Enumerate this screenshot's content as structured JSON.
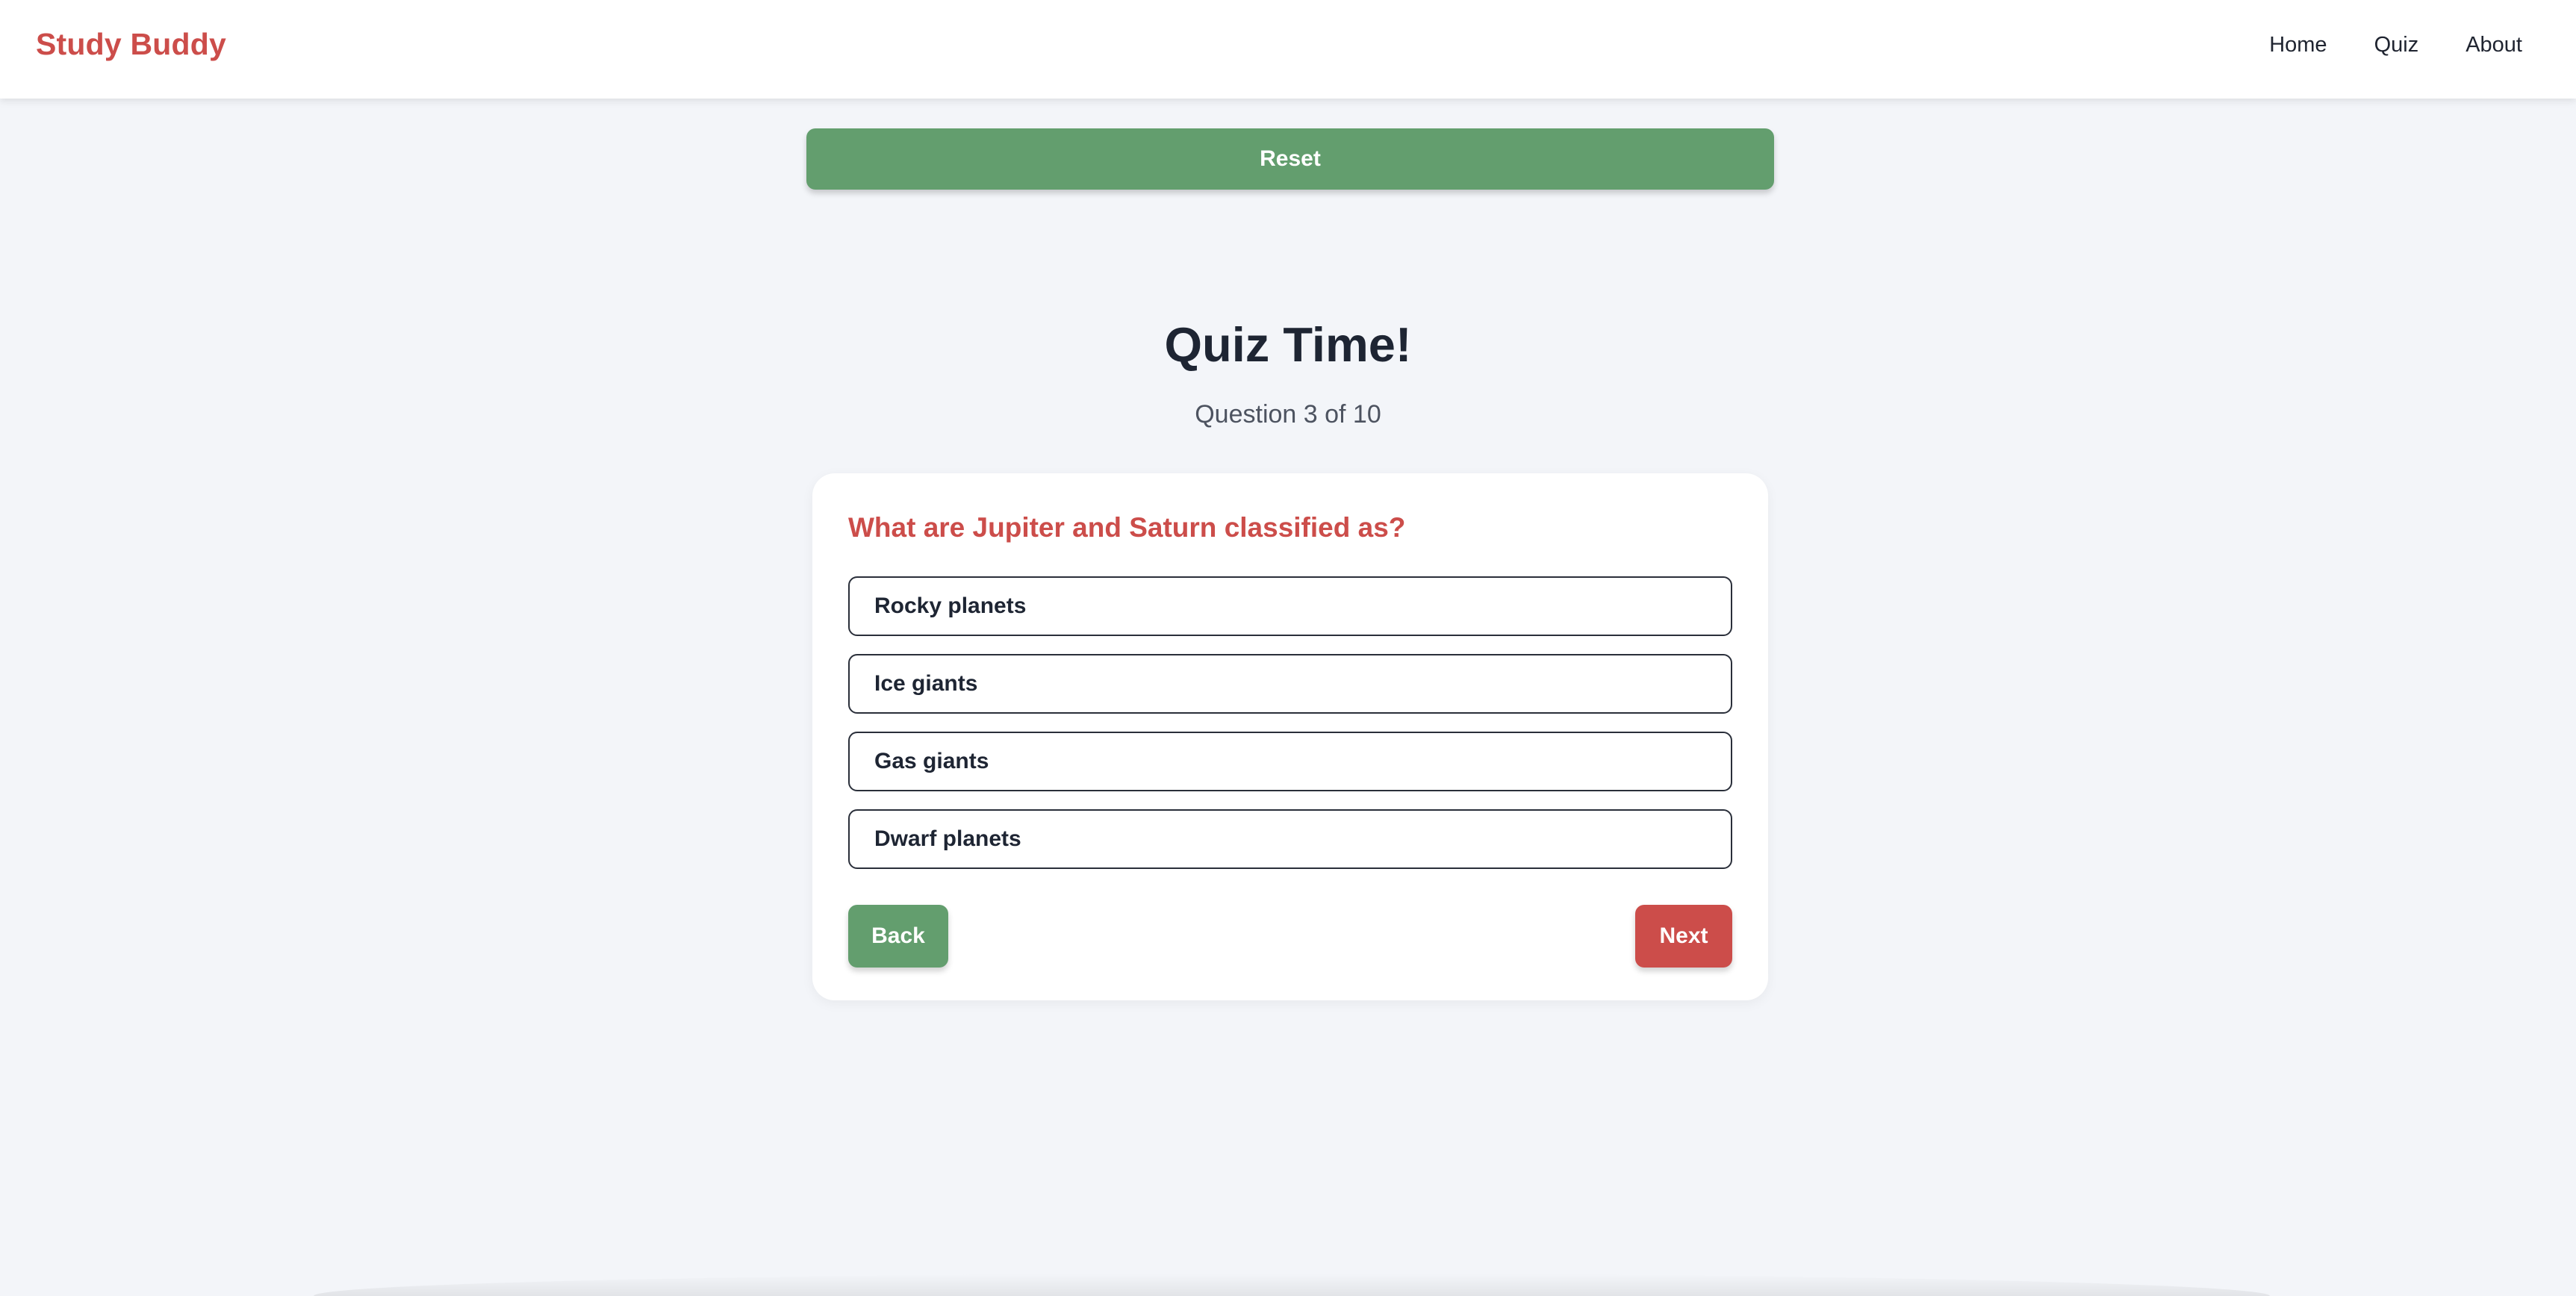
{
  "header": {
    "brand": "Study Buddy",
    "nav": [
      "Home",
      "Quiz",
      "About"
    ]
  },
  "toolbar": {
    "reset_label": "Reset"
  },
  "quiz": {
    "title": "Quiz Time!",
    "progress": "Question 3 of 10",
    "question": "What are Jupiter and Saturn classified as?",
    "options": [
      "Rocky planets",
      "Ice giants",
      "Gas giants",
      "Dwarf planets"
    ],
    "back_label": "Back",
    "next_label": "Next"
  },
  "colors": {
    "brand": "#cc4d4a",
    "green": "#639e6e",
    "red": "#cc4d4a",
    "background": "#f3f5f9"
  }
}
